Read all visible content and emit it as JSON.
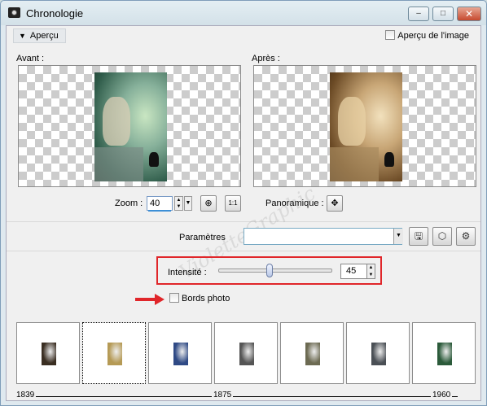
{
  "window": {
    "title": "Chronologie",
    "minimize": "–",
    "maximize": "□",
    "close": "✕"
  },
  "toolbar": {
    "apercu_label": "Aperçu",
    "apercu_image_label": "Aperçu de l'image"
  },
  "preview": {
    "before_label": "Avant :",
    "after_label": "Après :"
  },
  "zoom": {
    "label": "Zoom :",
    "value": "40",
    "fit_icon": "fit-window-icon",
    "actual_size_label": "1:1"
  },
  "pan": {
    "label": "Panoramique :",
    "icon": "move-icon"
  },
  "params": {
    "label": "Paramètres",
    "value": "",
    "save_icon": "save-icon",
    "randomize_icon": "dice-icon",
    "manage_icon": "manage-presets-icon"
  },
  "intensity": {
    "label": "Intensité :",
    "value": "45",
    "slider_level_percent": 45
  },
  "borders": {
    "label": "Bords photo",
    "checked": false
  },
  "thumbnails": [
    {
      "color": "#3a2e22",
      "selected": false
    },
    {
      "color": "#b59a55",
      "selected": true
    },
    {
      "color": "#2f4a85",
      "selected": false
    },
    {
      "color": "#555555",
      "selected": false
    },
    {
      "color": "#6c6a52",
      "selected": false
    },
    {
      "color": "#4a4f55",
      "selected": false
    },
    {
      "color": "#2b5a3a",
      "selected": false
    }
  ],
  "timeline": {
    "start": "1839",
    "mid": "1875",
    "end": "1960"
  },
  "watermark": "VioletteGraphic",
  "colors": {
    "accent": "#e0262a",
    "window_bg": "#f0f0f0"
  }
}
